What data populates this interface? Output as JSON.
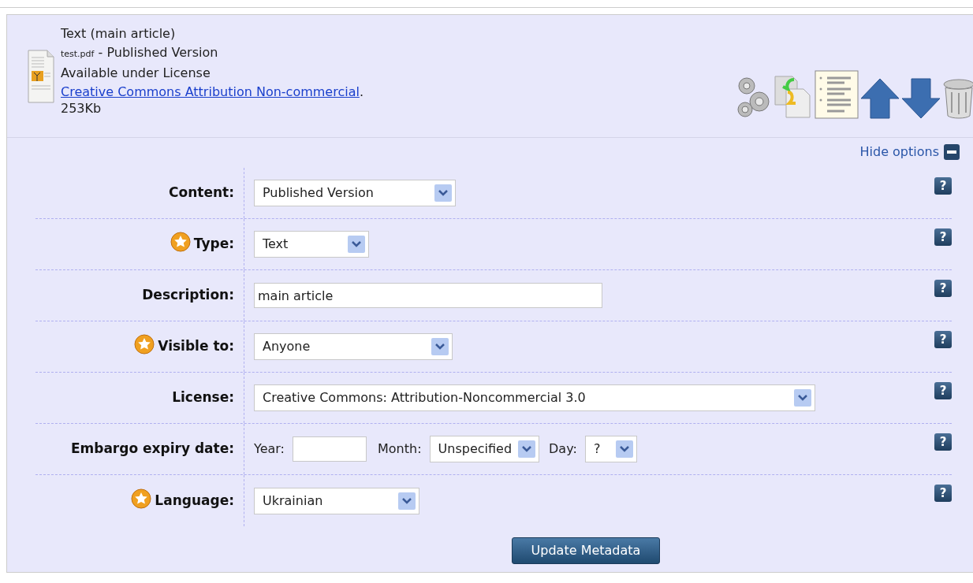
{
  "document": {
    "title": "Text (main article)",
    "filename": "test.pdf",
    "version": " - Published Version",
    "license_prefix": "Available under License ",
    "license_link": "Creative Commons Attribution Non-commercial",
    "license_suffix": ".",
    "size": "253Kb"
  },
  "options_toggle": {
    "label": "Hide options",
    "expanded": true
  },
  "fields": [
    {
      "label": "Content:",
      "required": false,
      "kind": "select",
      "value": "Published Version",
      "help": "?"
    },
    {
      "label": "Type:",
      "required": true,
      "kind": "select",
      "value": "Text",
      "help": "?"
    },
    {
      "label": "Description:",
      "required": false,
      "kind": "text",
      "value": "main article",
      "help": "?"
    },
    {
      "label": "Visible to:",
      "required": true,
      "kind": "select",
      "value": "Anyone",
      "help": "?"
    },
    {
      "label": "License:",
      "required": false,
      "kind": "select",
      "value": "Creative Commons: Attribution-Noncommercial 3.0",
      "help": "?"
    },
    {
      "label": "Embargo expiry date:",
      "required": false,
      "kind": "date",
      "year_label": "Year:",
      "month_label": "Month:",
      "month_value": "Unspecified",
      "day_label": "Day:",
      "day_value": "?",
      "help": "?"
    },
    {
      "label": "Language:",
      "required": true,
      "kind": "select",
      "value": "Ukrainian",
      "help": "?"
    }
  ],
  "button": "Update Metadata"
}
